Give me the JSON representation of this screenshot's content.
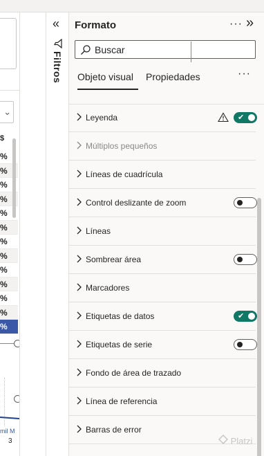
{
  "canvas": {
    "table_rows": [
      "%",
      "%",
      "%",
      "%",
      "%",
      "%",
      "%",
      "%",
      "%",
      "%",
      "%",
      "%",
      "%"
    ],
    "header_glyph": "$",
    "axis_label": "mil M",
    "axis_number": "3"
  },
  "filters_pane": {
    "label": "Filtros"
  },
  "format_pane": {
    "title": "Formato",
    "search_placeholder": "Buscar",
    "tabs": [
      {
        "label": "Objeto visual",
        "active": true
      },
      {
        "label": "Propiedades",
        "active": false
      }
    ],
    "sections": [
      {
        "label": "Leyenda",
        "toggle": "on",
        "warning": true,
        "disabled": false
      },
      {
        "label": "Múltiplos pequeños",
        "toggle": null,
        "warning": false,
        "disabled": true
      },
      {
        "label": "Líneas de cuadrícula",
        "toggle": null,
        "warning": false,
        "disabled": false
      },
      {
        "label": "Control deslizante de zoom",
        "toggle": "off",
        "warning": false,
        "disabled": false
      },
      {
        "label": "Líneas",
        "toggle": null,
        "warning": false,
        "disabled": false
      },
      {
        "label": "Sombrear área",
        "toggle": "off",
        "warning": false,
        "disabled": false
      },
      {
        "label": "Marcadores",
        "toggle": null,
        "warning": false,
        "disabled": false
      },
      {
        "label": "Etiquetas de datos",
        "toggle": "on",
        "warning": false,
        "disabled": false
      },
      {
        "label": "Etiquetas de serie",
        "toggle": "off",
        "warning": false,
        "disabled": false
      },
      {
        "label": "Fondo de área de trazado",
        "toggle": null,
        "warning": false,
        "disabled": false
      },
      {
        "label": "Línea de referencia",
        "toggle": null,
        "warning": false,
        "disabled": false
      },
      {
        "label": "Barras de error",
        "toggle": null,
        "warning": false,
        "disabled": false
      }
    ]
  },
  "watermark": "Platzi",
  "colors": {
    "toggle_on": "#117865",
    "selected_row": "#3b58a7"
  }
}
